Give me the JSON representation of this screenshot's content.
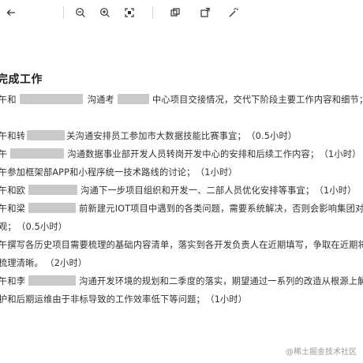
{
  "toolbar": {
    "buttons": [
      {
        "name": "back-icon"
      },
      {
        "name": "zoom-out-icon"
      },
      {
        "name": "zoom-in-icon"
      },
      {
        "name": "fit-to-window-icon"
      },
      {
        "name": "rotate-icon"
      },
      {
        "name": "magic-wand-icon"
      }
    ]
  },
  "document": {
    "heading": "完成工作",
    "lines": [
      {
        "a": "午和",
        "b": "沟通考",
        "c": "中心项目交接情况，交代下阶段主要工作内容和细节；"
      },
      {
        "a": "午和转",
        "b": "关沟通安排员工参加市大数据技能比赛事宜；",
        "c": "（0.5小时）"
      },
      {
        "a": "午",
        "b": "沟通数据事业部开发人员转岗开发中心的安排和后续工作内容；",
        "c": "（1小时）"
      },
      {
        "a": "午参加框架部APP和小程序统一技术路线的讨论；",
        "b": "",
        "c": "（1小时）"
      },
      {
        "a": "午和欧",
        "b": "沟通下一步项目组织和开发一、二部人员优化安排等事宜；",
        "c": "（1小时）"
      },
      {
        "a": "午和梁",
        "b": "前新建元IOT项目中遇到的各类问题，需要系统解决，否则会影响集团对测",
        "c": ""
      },
      {
        "a": "观；",
        "b": "（0.5小时）",
        "c": ""
      },
      {
        "a": "午撰写各历史项目需要梳理的基础内容清单，落实到各开发负责人在近期填写，争取在近期将",
        "b": "",
        "c": ""
      },
      {
        "a": "梳理清晰。",
        "b": "（2小时）",
        "c": ""
      },
      {
        "a": "午和李",
        "b": "沟通开发环境的规划和二季度的落实，期望通过一系列的改造从根源上解",
        "c": ""
      },
      {
        "a": "护和后期运维由于非标导致的工作效率低下等问题；",
        "b": "（1小时）",
        "c": ""
      }
    ]
  },
  "watermark": "@稀土掘金技术社区"
}
